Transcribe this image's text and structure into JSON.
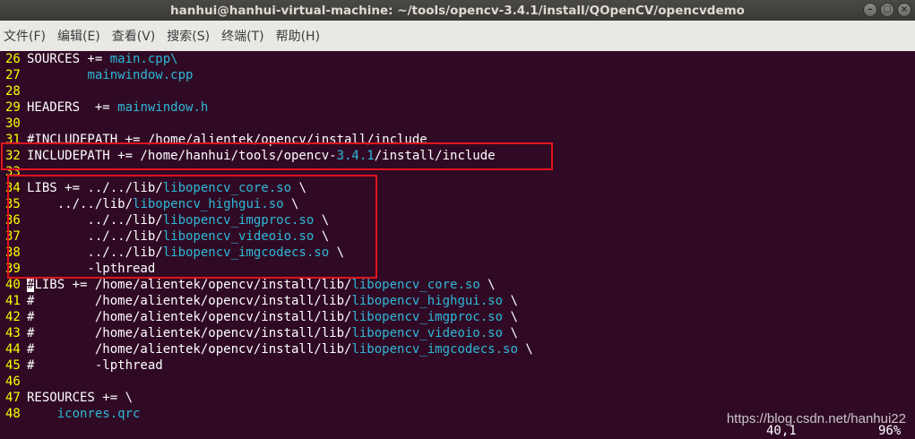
{
  "window": {
    "title": "hanhui@hanhui-virtual-machine: ~/tools/opencv-3.4.1/install/QOpenCV/opencvdemo",
    "minimize_glyph": "–",
    "maximize_glyph": "□",
    "close_glyph": "×"
  },
  "menu": [
    "文件(F)",
    "编辑(E)",
    "查看(V)",
    "搜索(S)",
    "终端(T)",
    "帮助(H)"
  ],
  "lines": [
    {
      "n": "26",
      "segs": [
        [
          "t",
          "SOURCES += "
        ],
        [
          "c",
          "main.cpp\\"
        ]
      ]
    },
    {
      "n": "27",
      "segs": [
        [
          "t",
          "        "
        ],
        [
          "c",
          "mainwindow.cpp"
        ]
      ]
    },
    {
      "n": "28",
      "segs": []
    },
    {
      "n": "29",
      "segs": [
        [
          "t",
          "HEADERS  += "
        ],
        [
          "c",
          "mainwindow.h"
        ]
      ]
    },
    {
      "n": "30",
      "segs": []
    },
    {
      "n": "31",
      "segs": [
        [
          "t",
          "#INCLUDEPATH += /home/alientek/opencv/install/include"
        ]
      ]
    },
    {
      "n": "32",
      "segs": [
        [
          "t",
          "INCLUDEPATH += /home/hanhui/tools/opencv-"
        ],
        [
          "c",
          "3.4.1"
        ],
        [
          "t",
          "/install/include"
        ]
      ]
    },
    {
      "n": "33",
      "segs": []
    },
    {
      "n": "34",
      "segs": [
        [
          "t",
          "LIBS += ../../lib/"
        ],
        [
          "c",
          "libopencv_core.so"
        ],
        [
          "t",
          " \\"
        ]
      ]
    },
    {
      "n": "35",
      "segs": [
        [
          "t",
          "    ../../lib/"
        ],
        [
          "c",
          "libopencv_highgui.so"
        ],
        [
          "t",
          " \\"
        ]
      ]
    },
    {
      "n": "36",
      "segs": [
        [
          "t",
          "        ../../lib/"
        ],
        [
          "c",
          "libopencv_imgproc.so"
        ],
        [
          "t",
          " \\"
        ]
      ]
    },
    {
      "n": "37",
      "segs": [
        [
          "t",
          "        ../../lib/"
        ],
        [
          "c",
          "libopencv_videoio.so"
        ],
        [
          "t",
          " \\"
        ]
      ]
    },
    {
      "n": "38",
      "segs": [
        [
          "t",
          "        ../../lib/"
        ],
        [
          "c",
          "libopencv_imgcodecs.so"
        ],
        [
          "t",
          " \\"
        ]
      ]
    },
    {
      "n": "39",
      "segs": [
        [
          "t",
          "        -lpthread"
        ]
      ]
    },
    {
      "n": "40",
      "segs": [
        [
          "k",
          "#"
        ],
        [
          "t",
          "LIBS += /home/alientek/opencv/install/lib/"
        ],
        [
          "c",
          "libopencv_core.so"
        ],
        [
          "t",
          " \\"
        ]
      ]
    },
    {
      "n": "41",
      "segs": [
        [
          "t",
          "#        /home/alientek/opencv/install/lib/"
        ],
        [
          "c",
          "libopencv_highgui.so"
        ],
        [
          "t",
          " \\"
        ]
      ]
    },
    {
      "n": "42",
      "segs": [
        [
          "t",
          "#        /home/alientek/opencv/install/lib/"
        ],
        [
          "c",
          "libopencv_imgproc.so"
        ],
        [
          "t",
          " \\"
        ]
      ]
    },
    {
      "n": "43",
      "segs": [
        [
          "t",
          "#        /home/alientek/opencv/install/lib/"
        ],
        [
          "c",
          "libopencv_videoio.so"
        ],
        [
          "t",
          " \\"
        ]
      ]
    },
    {
      "n": "44",
      "segs": [
        [
          "t",
          "#        /home/alientek/opencv/install/lib/"
        ],
        [
          "c",
          "libopencv_imgcodecs.so"
        ],
        [
          "t",
          " \\"
        ]
      ]
    },
    {
      "n": "45",
      "segs": [
        [
          "t",
          "#        -lpthread"
        ]
      ]
    },
    {
      "n": "46",
      "segs": []
    },
    {
      "n": "47",
      "segs": [
        [
          "t",
          "RESOURCES += \\"
        ]
      ]
    },
    {
      "n": "48",
      "segs": [
        [
          "t",
          "    "
        ],
        [
          "c",
          "iconres.qrc"
        ]
      ]
    }
  ],
  "status": {
    "position": "40,1",
    "percent": "96%"
  },
  "watermark": "https://blog.csdn.net/hanhui22",
  "colors": {
    "background": "#300a24",
    "line_number": "#ffff00",
    "highlight_text": "#2fb8d9",
    "annotation_box": "#e0141e"
  }
}
